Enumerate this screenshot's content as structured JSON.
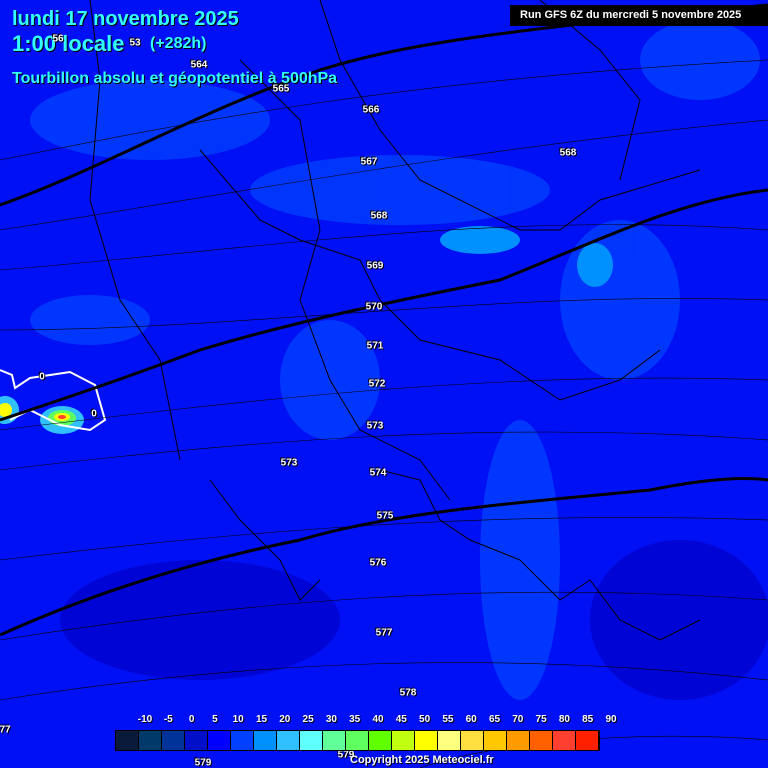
{
  "header": {
    "date": "lundi 17 novembre 2025",
    "time": "1:00 locale",
    "lead": "(+282h)",
    "parameter": "Tourbillon absolu et géopotentiel à 500hPa",
    "run": "Run GFS 6Z du mercredi 5 novembre 2025"
  },
  "contour_labels": [
    "56",
    "53",
    "564",
    "565",
    "566",
    "567",
    "568",
    "568",
    "569",
    "570",
    "571",
    "572",
    "573",
    "573",
    "574",
    "575",
    "576",
    "577",
    "578",
    "579",
    "579",
    "0",
    "0",
    "77"
  ],
  "legend": {
    "ticks": [
      "-10",
      "-5",
      "0",
      "5",
      "10",
      "15",
      "20",
      "25",
      "30",
      "35",
      "40",
      "45",
      "50",
      "55",
      "60",
      "65",
      "70",
      "75",
      "80",
      "85",
      "90"
    ],
    "colors": [
      "#0a1a3a",
      "#003a6a",
      "#00339a",
      "#0010c8",
      "#0000ff",
      "#0040ff",
      "#0090ff",
      "#30c0ff",
      "#60ffff",
      "#60ff9a",
      "#60ff60",
      "#60ff00",
      "#c0ff10",
      "#ffff00",
      "#ffff80",
      "#ffe040",
      "#ffc800",
      "#ff9a00",
      "#ff6000",
      "#ff4030",
      "#ff2000"
    ]
  },
  "copyright": "Copyright 2025 Meteociel.fr"
}
